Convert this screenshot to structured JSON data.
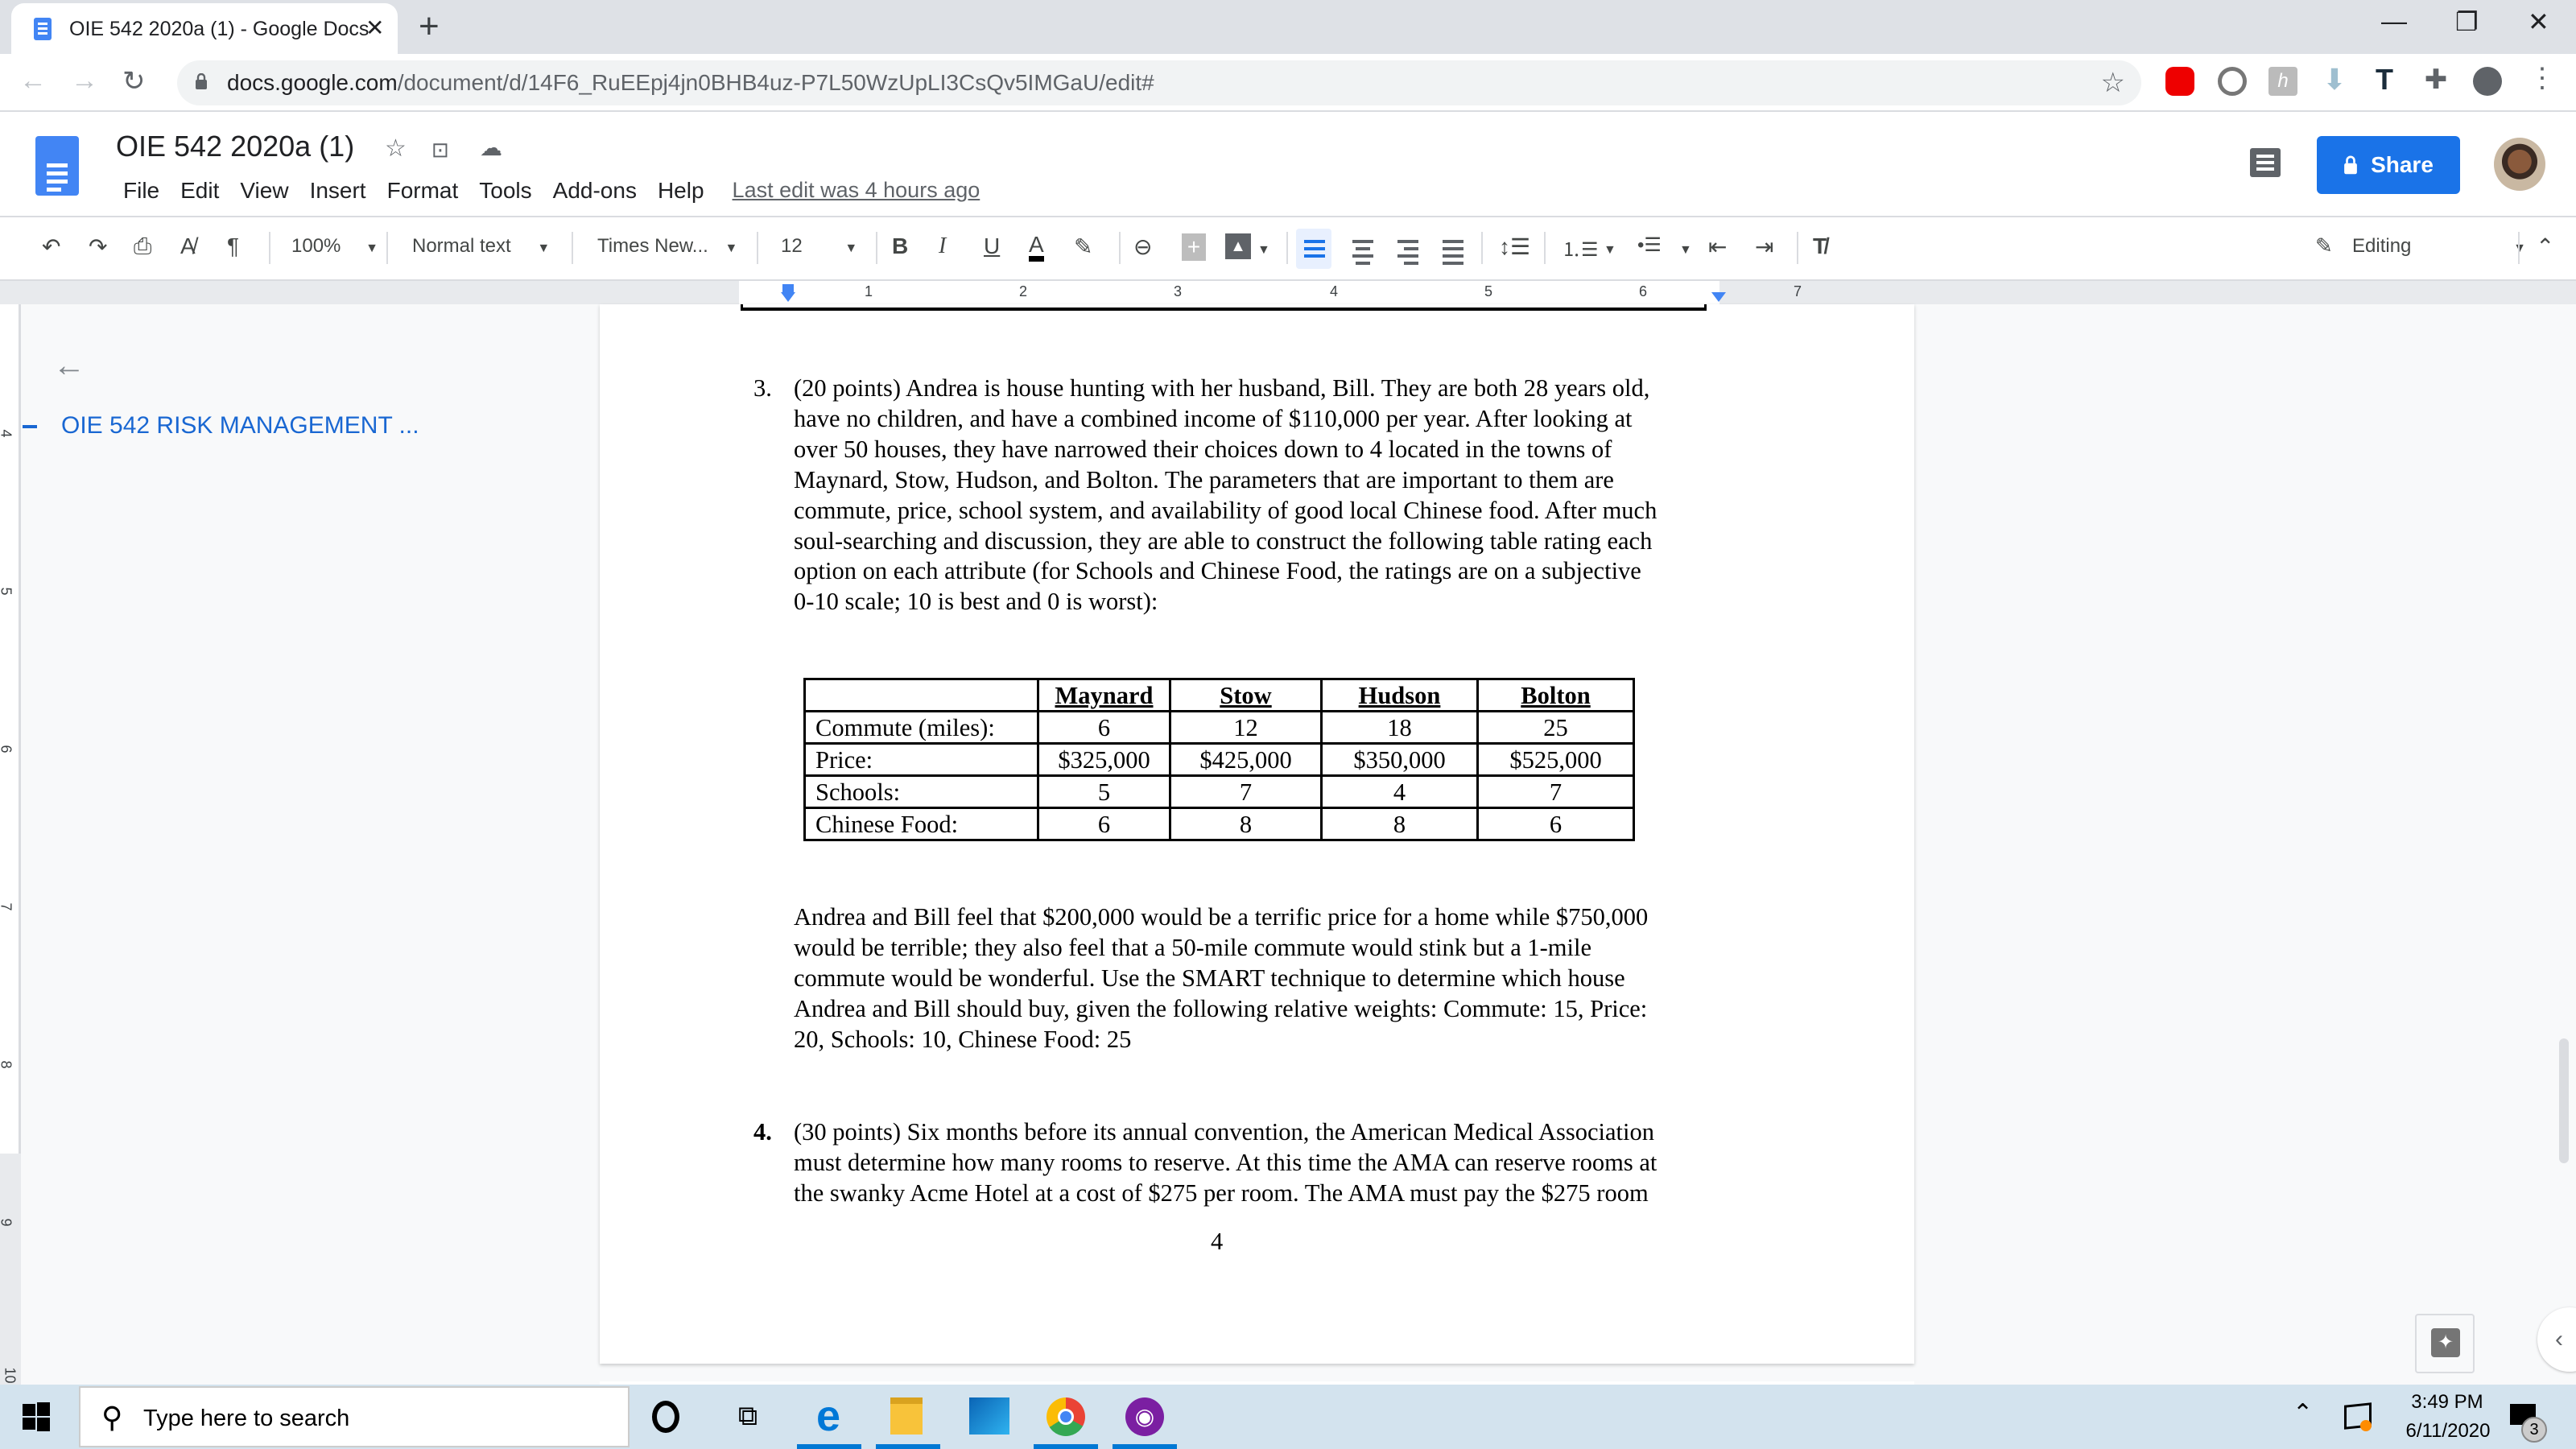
{
  "browser": {
    "tab_title": "OIE 542 2020a (1) - Google Docs",
    "tab_close": "✕",
    "new_tab": "+",
    "url_host": "docs.google.com",
    "url_path": "/document/d/14F6_RuEEpj4jn0BHB4uz-P7L50WzUpLI3CsQv5IMGaU/edit#",
    "window_controls": {
      "minimize": "—",
      "restore": "❐",
      "close": "✕"
    }
  },
  "docs_header": {
    "title": "OIE 542  2020a (1)",
    "menu": [
      "File",
      "Edit",
      "View",
      "Insert",
      "Format",
      "Tools",
      "Add-ons",
      "Help"
    ],
    "last_edit": "Last edit was 4 hours ago",
    "share_label": "Share"
  },
  "toolbar": {
    "zoom": "100%",
    "style": "Normal text",
    "font": "Times New...",
    "font_size": "12",
    "bold": "B",
    "italic": "I",
    "underline": "U",
    "text_color": "A",
    "mode": "Editing"
  },
  "ruler": {
    "numbers": [
      "1",
      "2",
      "3",
      "4",
      "5",
      "6",
      "7"
    ],
    "vertical_numbers": [
      "4",
      "5",
      "6",
      "7",
      "8",
      "9",
      "10"
    ]
  },
  "outline": {
    "item": "OIE 542 RISK MANAGEMENT ..."
  },
  "document": {
    "q3": {
      "number": "3.",
      "lines": [
        "(20 points) Andrea is house hunting with her husband, Bill. They are both 28 years old,",
        "have no children, and have a combined income of $110,000 per year. After looking at",
        "over 50 houses, they have narrowed their choices down to 4 located in the towns of",
        "Maynard, Stow, Hudson, and Bolton. The parameters that are important to them are",
        "commute, price, school system, and availability of good local Chinese food. After much",
        "soul-searching and discussion, they are able to construct the following table rating each",
        "option on each attribute (for Schools and Chinese Food, the ratings are on a subjective",
        "0-10 scale; 10 is best and 0 is worst):"
      ]
    },
    "table": {
      "headers": [
        "",
        "Maynard",
        "Stow",
        "Hudson",
        "Bolton"
      ],
      "rows": [
        [
          "Commute (miles):",
          "6",
          "12",
          "18",
          "25"
        ],
        [
          "Price:",
          "$325,000",
          "$425,000",
          "$350,000",
          "$525,000"
        ],
        [
          "Schools:",
          "5",
          "7",
          "4",
          "7"
        ],
        [
          "Chinese Food:",
          "6",
          "8",
          "8",
          "6"
        ]
      ]
    },
    "p2": {
      "lines": [
        "Andrea and Bill feel that $200,000 would be a terrific price for a home while $750,000",
        "would be terrible; they also feel that a 50-mile commute would stink but a 1-mile",
        "commute would be wonderful. Use the SMART technique to determine which house",
        "Andrea and Bill should buy, given the following relative weights:  Commute: 15, Price:",
        "20,   Schools: 10, Chinese Food:  25"
      ]
    },
    "q4": {
      "number": "4.",
      "lines": [
        "(30 points) Six months before its annual convention, the American Medical Association",
        "must determine how many rooms to reserve. At this time the AMA can reserve rooms at",
        "the swanky Acme Hotel at a cost of $275 per room. The AMA must pay the $275 room"
      ]
    },
    "page_number": "4"
  },
  "taskbar": {
    "search_placeholder": "Type here to search",
    "time": "3:49 PM",
    "date": "6/11/2020",
    "notification_count": "3"
  },
  "colors": {
    "accent": "#1a73e8",
    "outline_link": "#1967d2",
    "taskbar": "#d3e3ee"
  }
}
